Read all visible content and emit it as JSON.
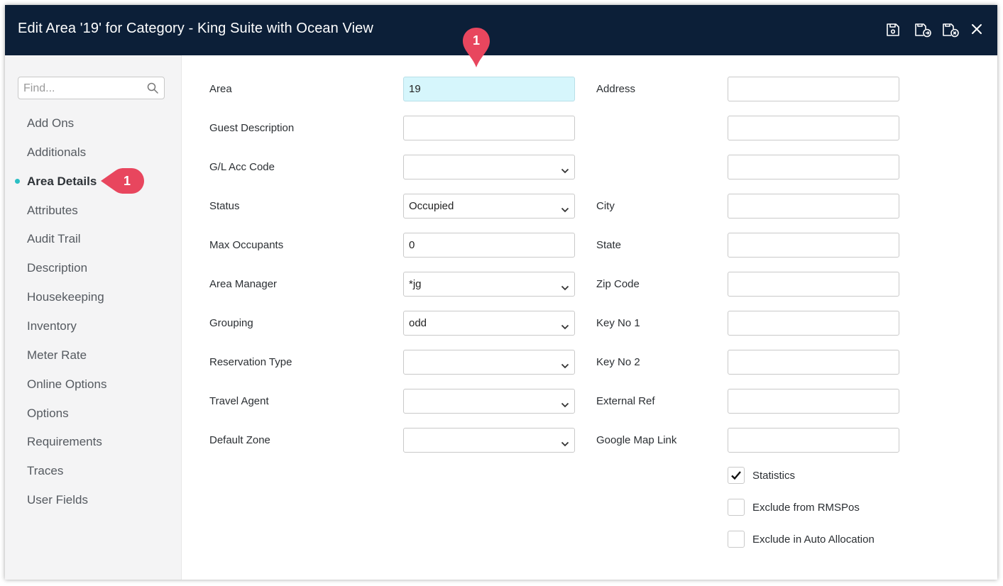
{
  "window": {
    "title": "Edit Area '19' for Category - King Suite with Ocean View"
  },
  "toolbar": {
    "icons": [
      "save-icon",
      "save-and-exit-icon",
      "save-and-close-icon",
      "close-icon"
    ]
  },
  "sidebar": {
    "search_placeholder": "Find...",
    "items": [
      {
        "label": "Add Ons"
      },
      {
        "label": "Additionals"
      },
      {
        "label": "Area Details",
        "active": true
      },
      {
        "label": "Attributes"
      },
      {
        "label": "Audit Trail"
      },
      {
        "label": "Description"
      },
      {
        "label": "Housekeeping"
      },
      {
        "label": "Inventory"
      },
      {
        "label": "Meter Rate"
      },
      {
        "label": "Online Options"
      },
      {
        "label": "Options"
      },
      {
        "label": "Requirements"
      },
      {
        "label": "Traces"
      },
      {
        "label": "User Fields"
      }
    ]
  },
  "annotations": {
    "top_marker": "1",
    "sidebar_marker": "1"
  },
  "colors": {
    "titlebar": "#0c1f38",
    "accent_dot": "#2bbfc4",
    "marker": "#e8465e",
    "highlight_field": "#d6f6fc"
  },
  "form": {
    "left": [
      {
        "label": "Area",
        "value": "19",
        "type": "text"
      },
      {
        "label": "Guest Description",
        "value": "",
        "type": "text"
      },
      {
        "label": "G/L Acc Code",
        "value": "",
        "type": "select"
      },
      {
        "label": "Status",
        "value": "Occupied",
        "type": "select"
      },
      {
        "label": "Max Occupants",
        "value": "0",
        "type": "text"
      },
      {
        "label": "Area Manager",
        "value": "*jg",
        "type": "select"
      },
      {
        "label": "Grouping",
        "value": "odd",
        "type": "select"
      },
      {
        "label": "Reservation Type",
        "value": "",
        "type": "select"
      },
      {
        "label": "Travel Agent",
        "value": "",
        "type": "select"
      },
      {
        "label": "Default Zone",
        "value": "",
        "type": "select"
      }
    ],
    "right": [
      {
        "label": "Address",
        "value": ""
      },
      {
        "label": "",
        "value": ""
      },
      {
        "label": "",
        "value": ""
      },
      {
        "label": "City",
        "value": ""
      },
      {
        "label": "State",
        "value": ""
      },
      {
        "label": "Zip Code",
        "value": ""
      },
      {
        "label": "Key No 1",
        "value": ""
      },
      {
        "label": "Key No 2",
        "value": ""
      },
      {
        "label": "External Ref",
        "value": ""
      },
      {
        "label": "Google Map Link",
        "value": ""
      }
    ],
    "checkboxes": [
      {
        "label": "Statistics",
        "checked": true
      },
      {
        "label": "Exclude from RMSPos",
        "checked": false
      },
      {
        "label": "Exclude in Auto Allocation",
        "checked": false
      }
    ]
  }
}
